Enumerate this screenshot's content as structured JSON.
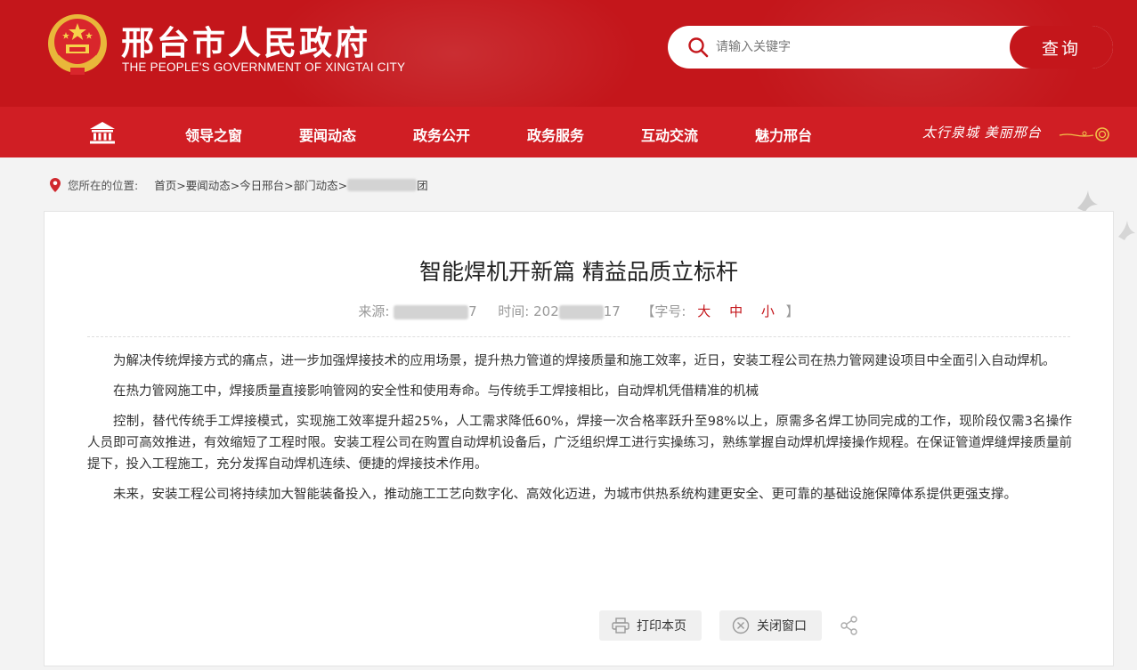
{
  "header": {
    "site_title": "邢台市人民政府",
    "site_subtitle": "THE PEOPLE'S GOVERNMENT OF XINGTAI CITY",
    "emblem_icon": "national-emblem-icon",
    "search": {
      "placeholder": "请输入关键字",
      "button_label": "查询",
      "icon": "search-icon"
    }
  },
  "nav": {
    "home_icon": "home-icon",
    "items": [
      {
        "label": "领导之窗"
      },
      {
        "label": "要闻动态"
      },
      {
        "label": "政务公开"
      },
      {
        "label": "政务服务"
      },
      {
        "label": "互动交流"
      },
      {
        "label": "魅力邢台"
      }
    ],
    "slogan": "太行泉城 美丽邢台"
  },
  "breadcrumb": {
    "label": "您所在的位置:",
    "path": "首页>要闻动态>今日邢台>部门动态>",
    "tail": "团"
  },
  "article": {
    "title": "智能焊机开新篇 精益品质立标杆",
    "source_label": "来源:",
    "source_prefix": "",
    "source_suffix": "7",
    "time_label": "时间:",
    "time_prefix": "202",
    "time_suffix": "17",
    "font_size_label": "【字号:",
    "font_size_options": [
      "大",
      "中",
      "小"
    ],
    "font_size_close": "】",
    "paragraphs": [
      "为解决传统焊接方式的痛点，进一步加强焊接技术的应用场景，提升热力管道的焊接质量和施工效率，近日，安装工程公司在热力管网建设项目中全面引入自动焊机。",
      "在热力管网施工中，焊接质量直接影响管网的安全性和使用寿命。与传统手工焊接相比，自动焊机凭借精准的机械",
      "控制，替代传统手工焊接模式，实现施工效率提升超25%，人工需求降低60%，焊接一次合格率跃升至98%以上，原需多名焊工协同完成的工作，现阶段仅需3名操作人员即可高效推进，有效缩短了工程时限。安装工程公司在购置自动焊机设备后，广泛组织焊工进行实操练习，熟练掌握自动焊机焊接操作规程。在保证管道焊缝焊接质量前提下，投入工程施工，充分发挥自动焊机连续、便捷的焊接技术作用。",
      "未来，安装工程公司将持续加大智能装备投入，推动施工工艺向数字化、高效化迈进，为城市供热系统构建更安全、更可靠的基础设施保障体系提供更强支撑。"
    ],
    "actions": {
      "print_label": "打印本页",
      "close_label": "关闭窗口",
      "share_icon": "share-icon"
    }
  },
  "colors": {
    "brand_red": "#c4161b",
    "nav_red": "#d01e24",
    "background": "#f3f3f3"
  }
}
